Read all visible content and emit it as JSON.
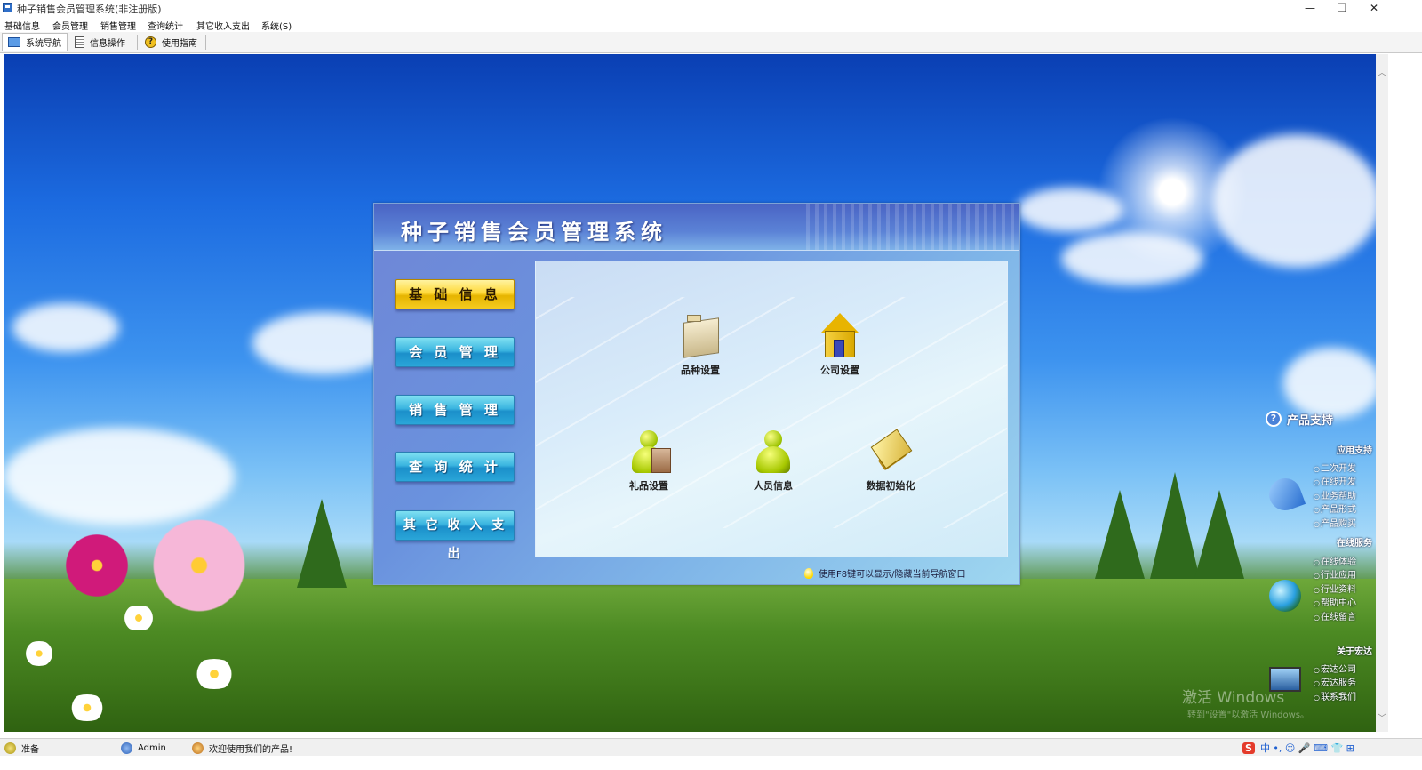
{
  "window": {
    "title": "种子销售会员管理系统(非注册版)",
    "controls": [
      "—",
      "❐",
      "✕"
    ]
  },
  "menu": [
    "基础信息",
    "会员管理",
    "销售管理",
    "查询统计",
    "其它收入支出",
    "系统(S)"
  ],
  "toolbar": {
    "nav": "系统导航",
    "info": "信息操作",
    "help": "使用指南"
  },
  "panel": {
    "title": "种子销售会员管理系统",
    "nav_buttons": [
      "基 础 信 息",
      "会 员 管 理",
      "销 售 管 理",
      "查 询 统 计",
      "其 它 收 入 支 出"
    ],
    "active_nav": 0,
    "tiles": [
      "品种设置",
      "公司设置",
      "礼品设置",
      "人员信息",
      "数据初始化"
    ],
    "hint": "使用F8键可以显示/隐藏当前导航窗口"
  },
  "support": {
    "title": "产品支持",
    "sections": [
      {
        "heading": "应用支持",
        "items": [
          "二次开发",
          "在线开发",
          "业务帮助",
          "产品形式",
          "产品购买"
        ]
      },
      {
        "heading": "在线服务",
        "items": [
          "在线体验",
          "行业应用",
          "行业资料",
          "帮助中心",
          "在线留言"
        ]
      },
      {
        "heading": "关于宏达",
        "items": [
          "宏达公司",
          "宏达服务",
          "联系我们"
        ]
      }
    ]
  },
  "watermark": {
    "line1": "激活 Windows",
    "line2": "转到\"设置\"以激活 Windows。"
  },
  "status": {
    "ready": "准备",
    "user": "Admin",
    "welcome": "欢迎使用我们的产品!"
  },
  "ime": {
    "logo": "S",
    "text": "中 •, ☺ 🎤 ⌨ 👕 ⊞"
  },
  "colors": {
    "sky_top": "#0a3fb3",
    "panel_header": "#4a64c4",
    "nav_active": "#ffd93a",
    "nav_normal": "#3bb5e0"
  }
}
